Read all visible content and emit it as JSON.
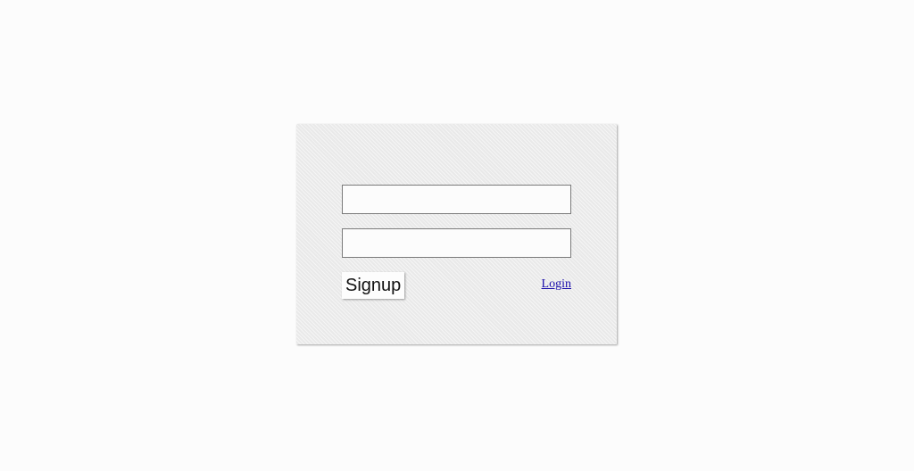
{
  "form": {
    "field_1": {
      "value": "",
      "placeholder": ""
    },
    "field_2": {
      "value": "",
      "placeholder": ""
    },
    "signup_label": "Signup",
    "login_label": "Login"
  }
}
